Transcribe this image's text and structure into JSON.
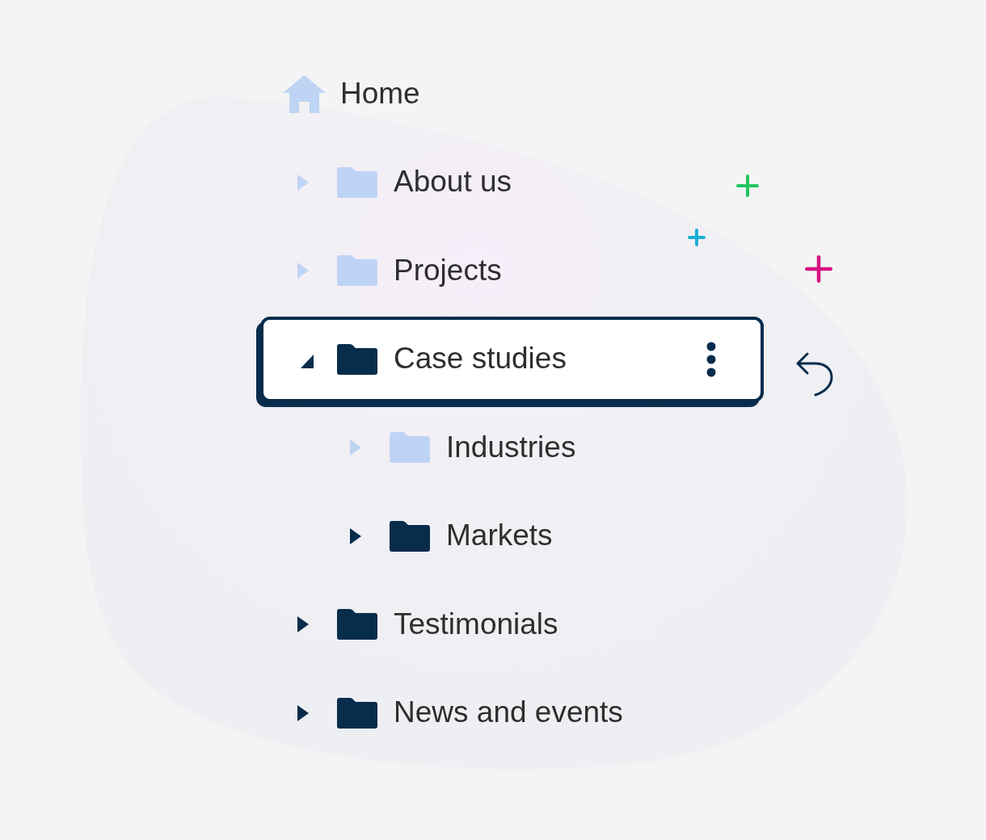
{
  "tree": {
    "nodes": [
      {
        "kind": "home",
        "label": "Home",
        "dimmed": true,
        "selected": false,
        "children": [
          {
            "kind": "folder",
            "label": "About us",
            "dimmed": true,
            "expanded": false,
            "selected": false
          },
          {
            "kind": "folder",
            "label": "Projects",
            "dimmed": true,
            "expanded": false,
            "selected": false
          },
          {
            "kind": "folder",
            "label": "Case studies",
            "dimmed": false,
            "expanded": true,
            "selected": true,
            "children": [
              {
                "kind": "folder",
                "label": "Industries",
                "dimmed": true,
                "expanded": false,
                "selected": false
              },
              {
                "kind": "folder",
                "label": "Markets",
                "dimmed": false,
                "expanded": false,
                "selected": false
              }
            ]
          },
          {
            "kind": "folder",
            "label": "Testimonials",
            "dimmed": false,
            "expanded": false,
            "selected": false
          },
          {
            "kind": "folder",
            "label": "News and events",
            "dimmed": false,
            "expanded": false,
            "selected": false
          }
        ]
      }
    ]
  },
  "sparkles": [
    {
      "color": "#22c55e"
    },
    {
      "color": "#1aaed6"
    },
    {
      "color": "#d6137f"
    }
  ]
}
